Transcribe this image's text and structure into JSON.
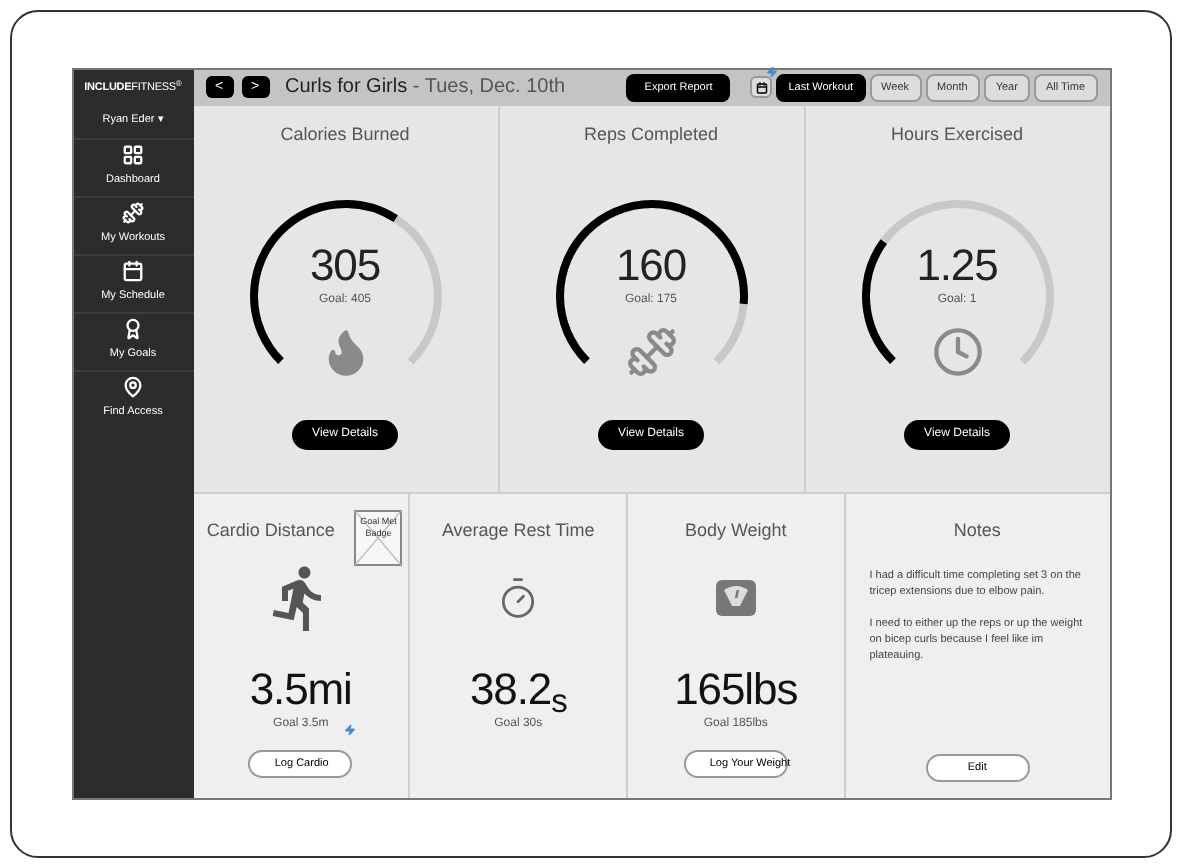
{
  "brand": {
    "bold": "INCLUDE",
    "rest": "FITNESS",
    "mark": "®"
  },
  "user": {
    "name": "Ryan Eder",
    "caret": "▾"
  },
  "sidebar": {
    "items": [
      {
        "label": "Dashboard"
      },
      {
        "label": "My Workouts"
      },
      {
        "label": "My Schedule"
      },
      {
        "label": "My Goals"
      },
      {
        "label": "Find Access"
      }
    ]
  },
  "header": {
    "prev": "<",
    "next": ">",
    "title": "Curls for Girls",
    "date": " - Tues, Dec. 10th",
    "export": "Export Report",
    "calendar_note": true,
    "ranges": [
      {
        "label": "Last Workout",
        "selected": true
      },
      {
        "label": "Week",
        "selected": false
      },
      {
        "label": "Month",
        "selected": false
      },
      {
        "label": "Year",
        "selected": false
      },
      {
        "label": "All Time",
        "selected": false
      }
    ]
  },
  "gauges": [
    {
      "title": "Calories Burned",
      "value": "305",
      "goal": "Goal: 405",
      "level": 0.62,
      "button": "View Details"
    },
    {
      "title": "Reps Completed",
      "value": "160",
      "goal": "Goal: 175",
      "level": 0.85,
      "button": "View Details"
    },
    {
      "title": "Hours Exercised",
      "value": "1.25",
      "goal": "Goal: 1",
      "level": 0.3,
      "button": "View Details"
    }
  ],
  "stats": [
    {
      "kind": "stat",
      "title": "Cardio Distance",
      "value": "3.5mi",
      "goal": "Goal 3.5m",
      "badge": "Goal Met Badge",
      "button": "Log Cardio",
      "button_note": true
    },
    {
      "kind": "stat",
      "title": "Average Rest Time",
      "value": "38.2$_{s}$",
      "goal": "Goal 30s"
    },
    {
      "kind": "stat",
      "title": "Body Weight",
      "value": "165lbs",
      "goal": "Goal 185lbs",
      "button": "Log Your Weight"
    },
    {
      "kind": "notes",
      "title": "Notes",
      "paragraphs": [
        "I had a difficult time completing set 3 on the tricep extensions due to elbow pain.",
        "I need to either up the reps or up the weight on bicep curls because I feel like im plateauing."
      ],
      "button": "Edit"
    }
  ]
}
